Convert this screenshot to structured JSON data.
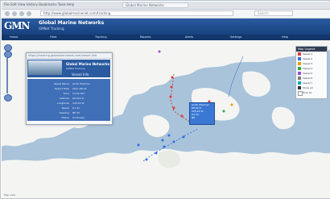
{
  "browser": {
    "menu": "File  Edit  View  History  Bookmarks  Tools  Help",
    "tab_title": "Global Marine Networks",
    "url": "http://www.globalmarinenet.com/tracking",
    "search_placeholder": "Search"
  },
  "app": {
    "logo": "GMN",
    "brand_title": "Global Marine Networks",
    "brand_sub": "GMNet Tracking",
    "nav": [
      "Home",
      "Fleet",
      "Tracking",
      "Reports",
      "Alerts",
      "Settings",
      "Help"
    ]
  },
  "popup": {
    "url": "https://tracking.globalmarinenet.com/vessel-info",
    "brand": "Global Marine Networks",
    "sub": "GMNet Tracking",
    "vessel": "Vessel Info",
    "rows": [
      {
        "k": "Vessel Name",
        "v": "Arctic Explorer"
      },
      {
        "k": "Report Date",
        "v": "2011-08-14"
      },
      {
        "k": "Time",
        "v": "14:32 UTC"
      },
      {
        "k": "Latitude",
        "v": "69.421 N"
      },
      {
        "k": "Longitude",
        "v": "105.22 W"
      },
      {
        "k": "Speed",
        "v": "6.2 kn"
      },
      {
        "k": "Heading",
        "v": "NE 45"
      },
      {
        "k": "Status",
        "v": "Underway"
      }
    ]
  },
  "vessel_box": [
    "Arctic Explorer",
    "69.42 N",
    "105.22 W",
    "6.2 kn",
    "NE"
  ],
  "legend": {
    "title": "Map Legend",
    "items": [
      {
        "label": "Vessel 1",
        "color": "#e23b3b"
      },
      {
        "label": "Vessel 2",
        "color": "#2f6fe0"
      },
      {
        "label": "Vessel 3",
        "color": "#e0a000"
      },
      {
        "label": "Vessel 4",
        "color": "#2aa84a"
      },
      {
        "label": "Vessel 5",
        "color": "#9a4bd1"
      },
      {
        "label": "Vessel 6",
        "color": "#7a7a7a"
      },
      {
        "label": "Vessel 7",
        "color": "#0aa8b8"
      },
      {
        "label": "Show all",
        "color": "#333333"
      },
      {
        "label": "Hide all",
        "color": "#ffffff"
      }
    ]
  },
  "credits": "Map data"
}
